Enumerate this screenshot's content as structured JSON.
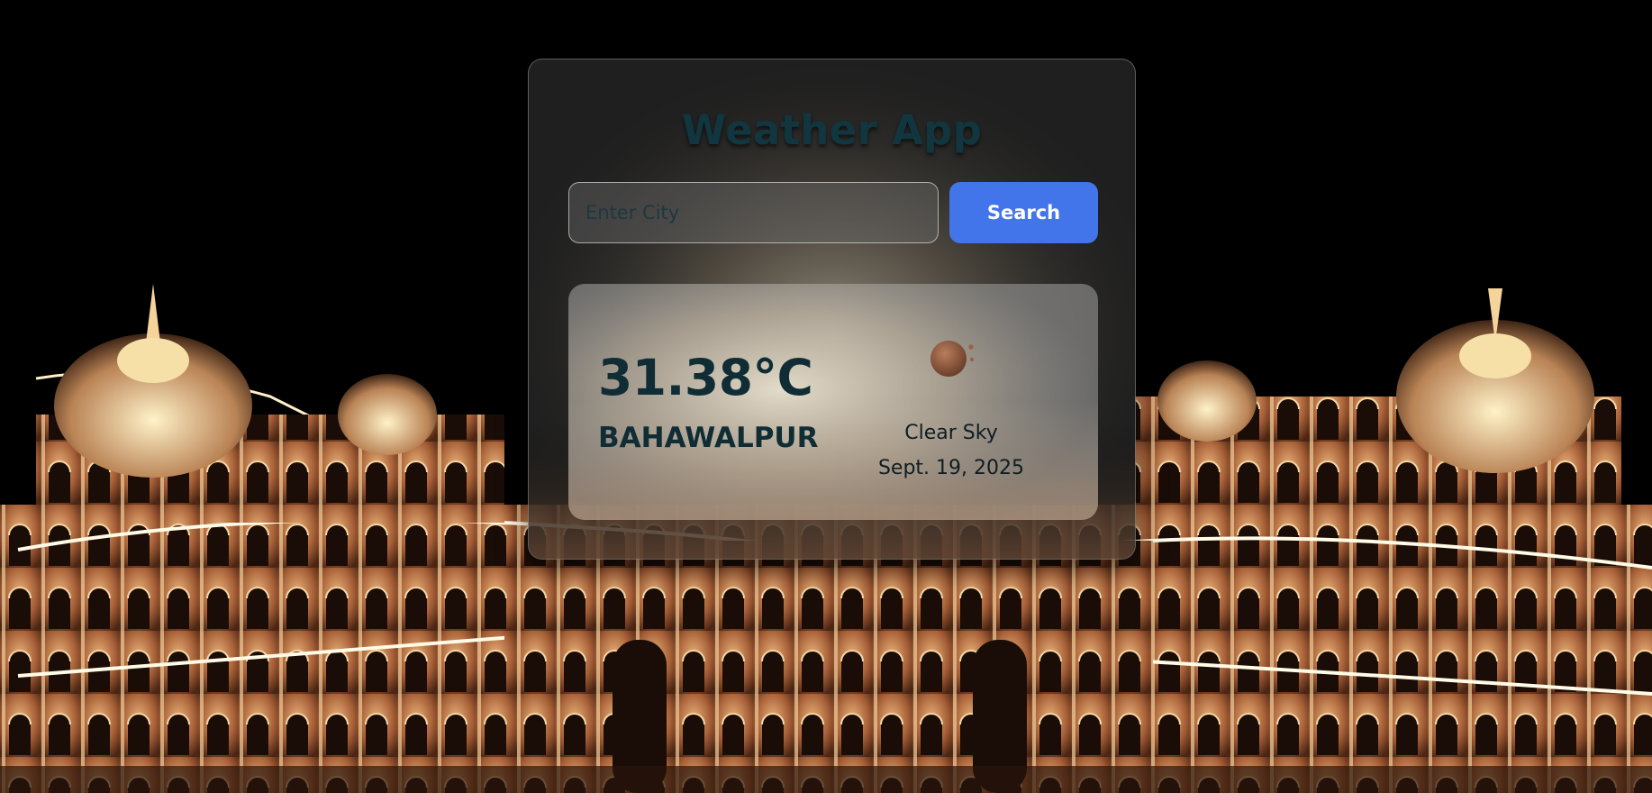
{
  "app": {
    "title": "Weather App"
  },
  "search": {
    "placeholder": "Enter City",
    "value": "",
    "button_label": "Search"
  },
  "weather": {
    "temperature": "31.38°C",
    "city": "BAHAWALPUR",
    "condition": "Clear Sky",
    "date": "Sept. 19, 2025",
    "icon": "clear-sky-night-icon"
  },
  "colors": {
    "accent": "#4375ea",
    "title_text": "#123640",
    "panel_bg": "#282828"
  }
}
